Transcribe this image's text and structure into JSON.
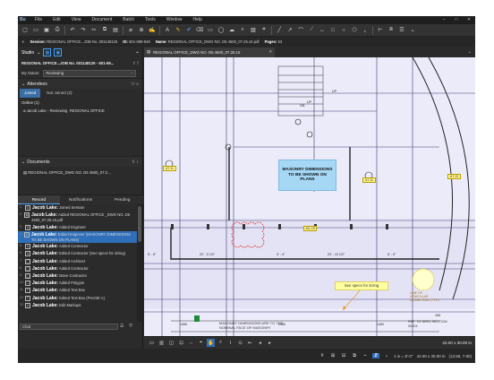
{
  "menu": [
    "File",
    "Edit",
    "View",
    "Document",
    "Batch",
    "Tools",
    "Window",
    "Help"
  ],
  "window_controls": [
    "–",
    "□",
    "✕"
  ],
  "session_bar": {
    "session_label": "Session:",
    "session_value": "REGIONAL OFFICE...JOB No. 001148125",
    "id_label": "ID:",
    "id_value": "601-698-846",
    "name_label": "Name:",
    "name_value": "REGIONAL OFFICE_DWG NO. D5 4500_07.25.16.pdf",
    "pages_label": "Pages:",
    "pages_value": "63"
  },
  "left_panel": {
    "studio_title": "Studio",
    "project": "REGIONAL OFFICE...JOB No. 001148125 - 601-69...",
    "my_status_label": "My Status:",
    "my_status_value": "Reviewing",
    "attendees_title": "Attendees",
    "tabs": [
      "Joined",
      "Not Joined (2)"
    ],
    "online_label": "Online (1)",
    "attendee": "Jacob Lake - Reviewing",
    "attendee_org": "REGIONAL OFFICE",
    "documents_title": "Documents",
    "document": "REGIONAL OFFICE_DWG NO. D5 4500_07.2...",
    "history_tabs": [
      "Record",
      "Notifications",
      "Pending"
    ],
    "history": [
      {
        "n": "1",
        "icon": "⊙",
        "who": "Jacob Lake:",
        "text": "Joined Session"
      },
      {
        "n": "2",
        "icon": "▤",
        "who": "Jacob Lake:",
        "text": "Added REGIONAL OFFICE _DWG NO. D5 4500_07.25.16.pdf"
      },
      {
        "n": "3",
        "icon": "A",
        "who": "Jacob Lake:",
        "text": "Added Engineer"
      },
      {
        "n": "4",
        "icon": "A",
        "who": "Jacob Lake:",
        "text": "Edited Engineer (MASONRY DIMENSIONS TO BE SHOWN ON PLANS)"
      },
      {
        "n": "5",
        "icon": "A",
        "who": "Jacob Lake:",
        "text": "Added Contractor"
      },
      {
        "n": "6",
        "icon": "A",
        "who": "Jacob Lake:",
        "text": "Edited Contractor (See specs for sizing)"
      },
      {
        "n": "7",
        "icon": "◯",
        "who": "Jacob Lake:",
        "text": "Added Architect"
      },
      {
        "n": "8",
        "icon": "◯",
        "who": "Jacob Lake:",
        "text": "Added Contractor"
      },
      {
        "n": "9",
        "icon": "◯",
        "who": "Jacob Lake:",
        "text": "Move Contractor"
      },
      {
        "n": "10",
        "icon": "⬠",
        "who": "Jacob Lake:",
        "text": "Added Polygon"
      },
      {
        "n": "11",
        "icon": "T",
        "who": "Jacob Lake:",
        "text": "Added Text Box"
      },
      {
        "n": "12",
        "icon": "T",
        "who": "Jacob Lake:",
        "text": "Edited Text Box (PHASE A)"
      },
      {
        "n": "13",
        "icon": "A",
        "who": "Jacob Lake:",
        "text": "Edit Markups"
      }
    ],
    "chat_placeholder": "Chat"
  },
  "doc_tab": "REGIONAL OFFICE_DWG NO. D5 4500_07.25.16",
  "drawing": {
    "masonry_note": "MASONRY DIMENSIONS TO BE SHOWN ON PLANS",
    "see_specs": "See specs for sizing",
    "masonry_small": "MASONRY DIMENSIONS ARE TO THE NOMINAL FACE OF MASONRY",
    "ref_spec": "REF. TO SPEC SECTION 00524",
    "line_of": "LINE OF VEHICULAR GUARD RAIL (TYP.)",
    "up_labels": [
      "UP",
      "ON",
      "UP"
    ],
    "tags": [
      "A7.11",
      "A7.11",
      "AD-X5",
      "A7.13"
    ],
    "dims": [
      "5' - 5\"",
      "22' - 0 1/2\"",
      "3' - 4\"",
      "23' - 10 1/2\"",
      "6' - 0\"",
      "1450",
      "2450",
      "1450",
      "165"
    ]
  },
  "nav": {
    "readout": "42.00 x 30.00 in"
  },
  "status": {
    "scale": "1 in = 8'-0\"",
    "size": "42.00 x 30.00 in",
    "coords": "(13.58, 7.90)"
  },
  "colors": {
    "accent": "#2f6eb8",
    "canvas": "#ecebfa",
    "note_fill": "#a6d8f5",
    "cloud": "#e0302a"
  }
}
